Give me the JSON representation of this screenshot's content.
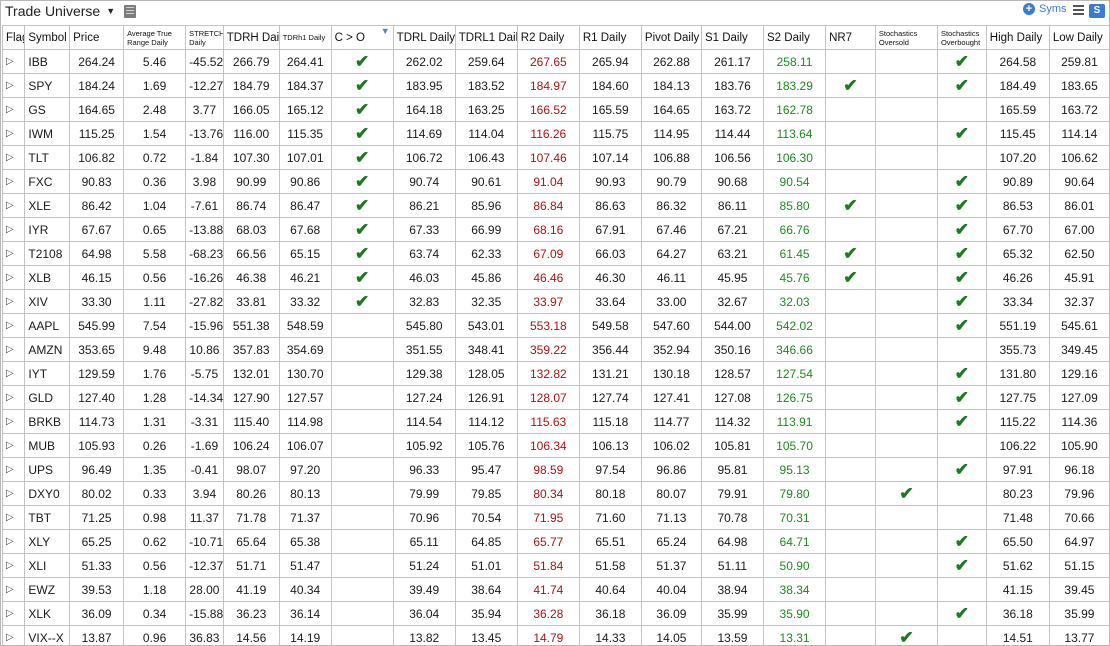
{
  "header": {
    "title": "Trade Universe",
    "title_caret": "▼",
    "syms_label": "Syms",
    "s_button": "S"
  },
  "colors": {
    "accent": "#3c7bd3",
    "up": "#1e8a1e",
    "down": "#a31515",
    "check": "#1e7a1e"
  },
  "columns": [
    {
      "label": "Flag",
      "small": false
    },
    {
      "label": "Symbol",
      "small": false
    },
    {
      "label": "Price",
      "small": false
    },
    {
      "label": "Average True Range Daily",
      "small": true
    },
    {
      "label": "STRETCH Daily",
      "small": true
    },
    {
      "label": "TDRH Daily",
      "small": false
    },
    {
      "label": "TDRh1 Daily",
      "small": true
    },
    {
      "label": "C > O",
      "small": false
    },
    {
      "label": "TDRL Daily",
      "small": false
    },
    {
      "label": "TDRL1 Daily",
      "small": false
    },
    {
      "label": "R2 Daily",
      "small": false
    },
    {
      "label": "R1 Daily",
      "small": false
    },
    {
      "label": "Pivot Daily",
      "small": false
    },
    {
      "label": "S1 Daily",
      "small": false
    },
    {
      "label": "S2 Daily",
      "small": false
    },
    {
      "label": "NR7",
      "small": false
    },
    {
      "label": "Stochastics Oversold",
      "small": true
    },
    {
      "label": "Stochastics Overbought",
      "small": true
    },
    {
      "label": "High Daily",
      "small": false
    },
    {
      "label": "Low Daily",
      "small": false
    }
  ],
  "flag_glyph": "▷",
  "check_glyph": "✔",
  "rows": [
    {
      "symbol": "IBB",
      "price": "264.24",
      "atr": "5.46",
      "stretch": "-45.52",
      "tdrh": "266.79",
      "tdrh1": "264.41",
      "co": true,
      "tdrl": "262.02",
      "tdrl1": "259.64",
      "r2": "267.65",
      "r1": "265.94",
      "pivot": "262.88",
      "s1": "261.17",
      "s2": "258.11",
      "nr7": false,
      "oversold": false,
      "overbought": true,
      "high": "264.58",
      "low": "259.81"
    },
    {
      "symbol": "SPY",
      "price": "184.24",
      "atr": "1.69",
      "stretch": "-12.27",
      "tdrh": "184.79",
      "tdrh1": "184.37",
      "co": true,
      "tdrl": "183.95",
      "tdrl1": "183.52",
      "r2": "184.97",
      "r1": "184.60",
      "pivot": "184.13",
      "s1": "183.76",
      "s2": "183.29",
      "nr7": true,
      "oversold": false,
      "overbought": true,
      "high": "184.49",
      "low": "183.65"
    },
    {
      "symbol": "GS",
      "price": "164.65",
      "atr": "2.48",
      "stretch": "3.77",
      "tdrh": "166.05",
      "tdrh1": "165.12",
      "co": true,
      "tdrl": "164.18",
      "tdrl1": "163.25",
      "r2": "166.52",
      "r1": "165.59",
      "pivot": "164.65",
      "s1": "163.72",
      "s2": "162.78",
      "nr7": false,
      "oversold": false,
      "overbought": false,
      "high": "165.59",
      "low": "163.72"
    },
    {
      "symbol": "IWM",
      "price": "115.25",
      "atr": "1.54",
      "stretch": "-13.76",
      "tdrh": "116.00",
      "tdrh1": "115.35",
      "co": true,
      "tdrl": "114.69",
      "tdrl1": "114.04",
      "r2": "116.26",
      "r1": "115.75",
      "pivot": "114.95",
      "s1": "114.44",
      "s2": "113.64",
      "nr7": false,
      "oversold": false,
      "overbought": true,
      "high": "115.45",
      "low": "114.14"
    },
    {
      "symbol": "TLT",
      "price": "106.82",
      "atr": "0.72",
      "stretch": "-1.84",
      "tdrh": "107.30",
      "tdrh1": "107.01",
      "co": true,
      "tdrl": "106.72",
      "tdrl1": "106.43",
      "r2": "107.46",
      "r1": "107.14",
      "pivot": "106.88",
      "s1": "106.56",
      "s2": "106.30",
      "nr7": false,
      "oversold": false,
      "overbought": false,
      "high": "107.20",
      "low": "106.62"
    },
    {
      "symbol": "FXC",
      "price": "90.83",
      "atr": "0.36",
      "stretch": "3.98",
      "tdrh": "90.99",
      "tdrh1": "90.86",
      "co": true,
      "tdrl": "90.74",
      "tdrl1": "90.61",
      "r2": "91.04",
      "r1": "90.93",
      "pivot": "90.79",
      "s1": "90.68",
      "s2": "90.54",
      "nr7": false,
      "oversold": false,
      "overbought": true,
      "high": "90.89",
      "low": "90.64"
    },
    {
      "symbol": "XLE",
      "price": "86.42",
      "atr": "1.04",
      "stretch": "-7.61",
      "tdrh": "86.74",
      "tdrh1": "86.47",
      "co": true,
      "tdrl": "86.21",
      "tdrl1": "85.96",
      "r2": "86.84",
      "r1": "86.63",
      "pivot": "86.32",
      "s1": "86.11",
      "s2": "85.80",
      "nr7": true,
      "oversold": false,
      "overbought": true,
      "high": "86.53",
      "low": "86.01"
    },
    {
      "symbol": "IYR",
      "price": "67.67",
      "atr": "0.65",
      "stretch": "-13.88",
      "tdrh": "68.03",
      "tdrh1": "67.68",
      "co": true,
      "tdrl": "67.33",
      "tdrl1": "66.99",
      "r2": "68.16",
      "r1": "67.91",
      "pivot": "67.46",
      "s1": "67.21",
      "s2": "66.76",
      "nr7": false,
      "oversold": false,
      "overbought": true,
      "high": "67.70",
      "low": "67.00"
    },
    {
      "symbol": "T2108",
      "price": "64.98",
      "atr": "5.58",
      "stretch": "-68.23",
      "tdrh": "66.56",
      "tdrh1": "65.15",
      "co": true,
      "tdrl": "63.74",
      "tdrl1": "62.33",
      "r2": "67.09",
      "r1": "66.03",
      "pivot": "64.27",
      "s1": "63.21",
      "s2": "61.45",
      "nr7": true,
      "oversold": false,
      "overbought": true,
      "high": "65.32",
      "low": "62.50"
    },
    {
      "symbol": "XLB",
      "price": "46.15",
      "atr": "0.56",
      "stretch": "-16.26",
      "tdrh": "46.38",
      "tdrh1": "46.21",
      "co": true,
      "tdrl": "46.03",
      "tdrl1": "45.86",
      "r2": "46.46",
      "r1": "46.30",
      "pivot": "46.11",
      "s1": "45.95",
      "s2": "45.76",
      "nr7": true,
      "oversold": false,
      "overbought": true,
      "high": "46.26",
      "low": "45.91"
    },
    {
      "symbol": "XIV",
      "price": "33.30",
      "atr": "1.11",
      "stretch": "-27.82",
      "tdrh": "33.81",
      "tdrh1": "33.32",
      "co": true,
      "tdrl": "32.83",
      "tdrl1": "32.35",
      "r2": "33.97",
      "r1": "33.64",
      "pivot": "33.00",
      "s1": "32.67",
      "s2": "32.03",
      "nr7": false,
      "oversold": false,
      "overbought": true,
      "high": "33.34",
      "low": "32.37"
    },
    {
      "symbol": "AAPL",
      "price": "545.99",
      "atr": "7.54",
      "stretch": "-15.96",
      "tdrh": "551.38",
      "tdrh1": "548.59",
      "co": false,
      "tdrl": "545.80",
      "tdrl1": "543.01",
      "r2": "553.18",
      "r1": "549.58",
      "pivot": "547.60",
      "s1": "544.00",
      "s2": "542.02",
      "nr7": false,
      "oversold": false,
      "overbought": true,
      "high": "551.19",
      "low": "545.61"
    },
    {
      "symbol": "AMZN",
      "price": "353.65",
      "atr": "9.48",
      "stretch": "10.86",
      "tdrh": "357.83",
      "tdrh1": "354.69",
      "co": false,
      "tdrl": "351.55",
      "tdrl1": "348.41",
      "r2": "359.22",
      "r1": "356.44",
      "pivot": "352.94",
      "s1": "350.16",
      "s2": "346.66",
      "nr7": false,
      "oversold": false,
      "overbought": false,
      "high": "355.73",
      "low": "349.45"
    },
    {
      "symbol": "IYT",
      "price": "129.59",
      "atr": "1.76",
      "stretch": "-5.75",
      "tdrh": "132.01",
      "tdrh1": "130.70",
      "co": false,
      "tdrl": "129.38",
      "tdrl1": "128.05",
      "r2": "132.82",
      "r1": "131.21",
      "pivot": "130.18",
      "s1": "128.57",
      "s2": "127.54",
      "nr7": false,
      "oversold": false,
      "overbought": true,
      "high": "131.80",
      "low": "129.16"
    },
    {
      "symbol": "GLD",
      "price": "127.40",
      "atr": "1.28",
      "stretch": "-14.34",
      "tdrh": "127.90",
      "tdrh1": "127.57",
      "co": false,
      "tdrl": "127.24",
      "tdrl1": "126.91",
      "r2": "128.07",
      "r1": "127.74",
      "pivot": "127.41",
      "s1": "127.08",
      "s2": "126.75",
      "nr7": false,
      "oversold": false,
      "overbought": true,
      "high": "127.75",
      "low": "127.09"
    },
    {
      "symbol": "BRKB",
      "price": "114.73",
      "atr": "1.31",
      "stretch": "-3.31",
      "tdrh": "115.40",
      "tdrh1": "114.98",
      "co": false,
      "tdrl": "114.54",
      "tdrl1": "114.12",
      "r2": "115.63",
      "r1": "115.18",
      "pivot": "114.77",
      "s1": "114.32",
      "s2": "113.91",
      "nr7": false,
      "oversold": false,
      "overbought": true,
      "high": "115.22",
      "low": "114.36"
    },
    {
      "symbol": "MUB",
      "price": "105.93",
      "atr": "0.26",
      "stretch": "-1.69",
      "tdrh": "106.24",
      "tdrh1": "106.07",
      "co": false,
      "tdrl": "105.92",
      "tdrl1": "105.76",
      "r2": "106.34",
      "r1": "106.13",
      "pivot": "106.02",
      "s1": "105.81",
      "s2": "105.70",
      "nr7": false,
      "oversold": false,
      "overbought": false,
      "high": "106.22",
      "low": "105.90"
    },
    {
      "symbol": "UPS",
      "price": "96.49",
      "atr": "1.35",
      "stretch": "-0.41",
      "tdrh": "98.07",
      "tdrh1": "97.20",
      "co": false,
      "tdrl": "96.33",
      "tdrl1": "95.47",
      "r2": "98.59",
      "r1": "97.54",
      "pivot": "96.86",
      "s1": "95.81",
      "s2": "95.13",
      "nr7": false,
      "oversold": false,
      "overbought": true,
      "high": "97.91",
      "low": "96.18"
    },
    {
      "symbol": "DXY0",
      "price": "80.02",
      "atr": "0.33",
      "stretch": "3.94",
      "tdrh": "80.26",
      "tdrh1": "80.13",
      "co": false,
      "tdrl": "79.99",
      "tdrl1": "79.85",
      "r2": "80.34",
      "r1": "80.18",
      "pivot": "80.07",
      "s1": "79.91",
      "s2": "79.80",
      "nr7": false,
      "oversold": true,
      "overbought": false,
      "high": "80.23",
      "low": "79.96"
    },
    {
      "symbol": "TBT",
      "price": "71.25",
      "atr": "0.98",
      "stretch": "11.37",
      "tdrh": "71.78",
      "tdrh1": "71.37",
      "co": false,
      "tdrl": "70.96",
      "tdrl1": "70.54",
      "r2": "71.95",
      "r1": "71.60",
      "pivot": "71.13",
      "s1": "70.78",
      "s2": "70.31",
      "nr7": false,
      "oversold": false,
      "overbought": false,
      "high": "71.48",
      "low": "70.66"
    },
    {
      "symbol": "XLY",
      "price": "65.25",
      "atr": "0.62",
      "stretch": "-10.71",
      "tdrh": "65.64",
      "tdrh1": "65.38",
      "co": false,
      "tdrl": "65.11",
      "tdrl1": "64.85",
      "r2": "65.77",
      "r1": "65.51",
      "pivot": "65.24",
      "s1": "64.98",
      "s2": "64.71",
      "nr7": false,
      "oversold": false,
      "overbought": true,
      "high": "65.50",
      "low": "64.97"
    },
    {
      "symbol": "XLI",
      "price": "51.33",
      "atr": "0.56",
      "stretch": "-12.37",
      "tdrh": "51.71",
      "tdrh1": "51.47",
      "co": false,
      "tdrl": "51.24",
      "tdrl1": "51.01",
      "r2": "51.84",
      "r1": "51.58",
      "pivot": "51.37",
      "s1": "51.11",
      "s2": "50.90",
      "nr7": false,
      "oversold": false,
      "overbought": true,
      "high": "51.62",
      "low": "51.15"
    },
    {
      "symbol": "EWZ",
      "price": "39.53",
      "atr": "1.18",
      "stretch": "28.00",
      "tdrh": "41.19",
      "tdrh1": "40.34",
      "co": false,
      "tdrl": "39.49",
      "tdrl1": "38.64",
      "r2": "41.74",
      "r1": "40.64",
      "pivot": "40.04",
      "s1": "38.94",
      "s2": "38.34",
      "nr7": false,
      "oversold": false,
      "overbought": false,
      "high": "41.15",
      "low": "39.45"
    },
    {
      "symbol": "XLK",
      "price": "36.09",
      "atr": "0.34",
      "stretch": "-15.88",
      "tdrh": "36.23",
      "tdrh1": "36.14",
      "co": false,
      "tdrl": "36.04",
      "tdrl1": "35.94",
      "r2": "36.28",
      "r1": "36.18",
      "pivot": "36.09",
      "s1": "35.99",
      "s2": "35.90",
      "nr7": false,
      "oversold": false,
      "overbought": true,
      "high": "36.18",
      "low": "35.99"
    },
    {
      "symbol": "VIX--X",
      "price": "13.87",
      "atr": "0.96",
      "stretch": "36.83",
      "tdrh": "14.56",
      "tdrh1": "14.19",
      "co": false,
      "tdrl": "13.82",
      "tdrl1": "13.45",
      "r2": "14.79",
      "r1": "14.33",
      "pivot": "14.05",
      "s1": "13.59",
      "s2": "13.31",
      "nr7": false,
      "oversold": true,
      "overbought": false,
      "high": "14.51",
      "low": "13.77"
    }
  ]
}
